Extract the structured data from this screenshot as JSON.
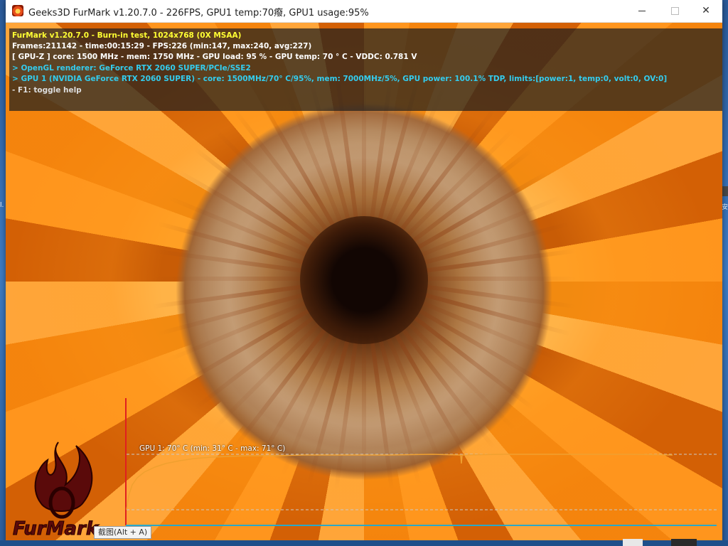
{
  "window": {
    "title": "Geeks3D FurMark v1.20.7.0 - 226FPS, GPU1 temp:70癈, GPU1 usage:95%",
    "minimize_icon": "minimize-icon",
    "maximize_icon": "maximize-icon",
    "close_icon": "close-icon",
    "close_glyph": "✕"
  },
  "info": {
    "line1": "FurMark v1.20.7.0 - Burn-in test, 1024x768 (0X MSAA)",
    "line2": "Frames:211142 - time:00:15:29 - FPS:226 (min:147, max:240, avg:227)",
    "line3": "[ GPU-Z ] core: 1500 MHz - mem: 1750 MHz - GPU load: 95 % - GPU temp: 70 ° C - VDDC: 0.781 V",
    "line4": "> OpenGL renderer: GeForce RTX 2060 SUPER/PCIe/SSE2",
    "line5": "> GPU 1 (NVIDIA GeForce RTX 2060 SUPER) - core: 1500MHz/70° C/95%, mem: 7000MHz/5%, GPU power: 100.1% TDP, limits:[power:1, temp:0, volt:0, OV:0]",
    "line6": "- F1: toggle help",
    "colors": {
      "line1": "#ffff33",
      "line2": "#ffffff",
      "line3": "#ffffff",
      "line4": "#33ccee",
      "line5": "#33ccee",
      "line6": "#dddddd"
    }
  },
  "graph": {
    "label": "GPU 1: 70° C (min: 31° C - max: 71° C)",
    "colors": {
      "curve": "#f0a030",
      "axis": "#2aa8c8",
      "marker": "#e02020",
      "guide": "#c8c8c8"
    }
  },
  "logo": {
    "text": "FurMark"
  },
  "tooltip": {
    "text": "截图(Alt + A)"
  },
  "desktop": {
    "fragment_b": "安",
    "fragment_c": "l."
  }
}
